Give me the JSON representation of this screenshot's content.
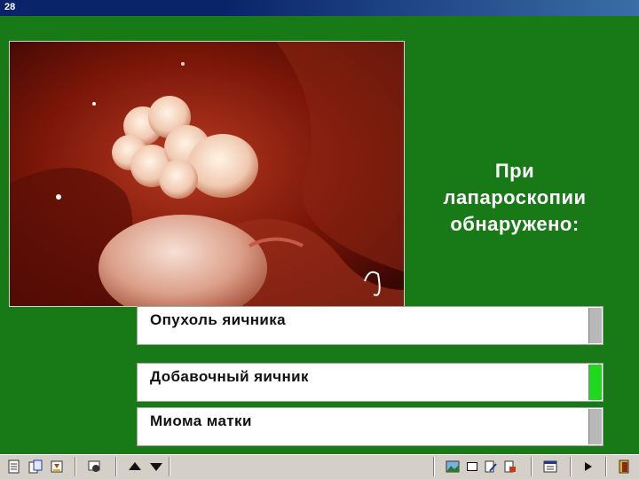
{
  "window": {
    "title": "28"
  },
  "photo": {
    "alt_icon": "laparoscopy-photo"
  },
  "question": {
    "heading_line1": "При",
    "heading_line2": "лапароскопии",
    "heading_line3": "обнаружено:"
  },
  "options": [
    {
      "label": "Опухоль яичника",
      "selected": false
    },
    {
      "label": "Добавочный яичник",
      "selected": true
    },
    {
      "label": "Миома матки",
      "selected": false
    }
  ],
  "colors": {
    "background": "#177a17",
    "selected_indicator": "#20d820",
    "indicator": "#b8b8b8"
  },
  "toolbar": {
    "icons": [
      "notes-icon",
      "copy-icon",
      "export-icon",
      "mask-icon",
      "prev-arrow-icon",
      "next-arrow-icon",
      "picture-icon",
      "window-icon",
      "edit-icon",
      "print-icon",
      "calculator-icon",
      "play-icon",
      "exit-icon"
    ]
  }
}
